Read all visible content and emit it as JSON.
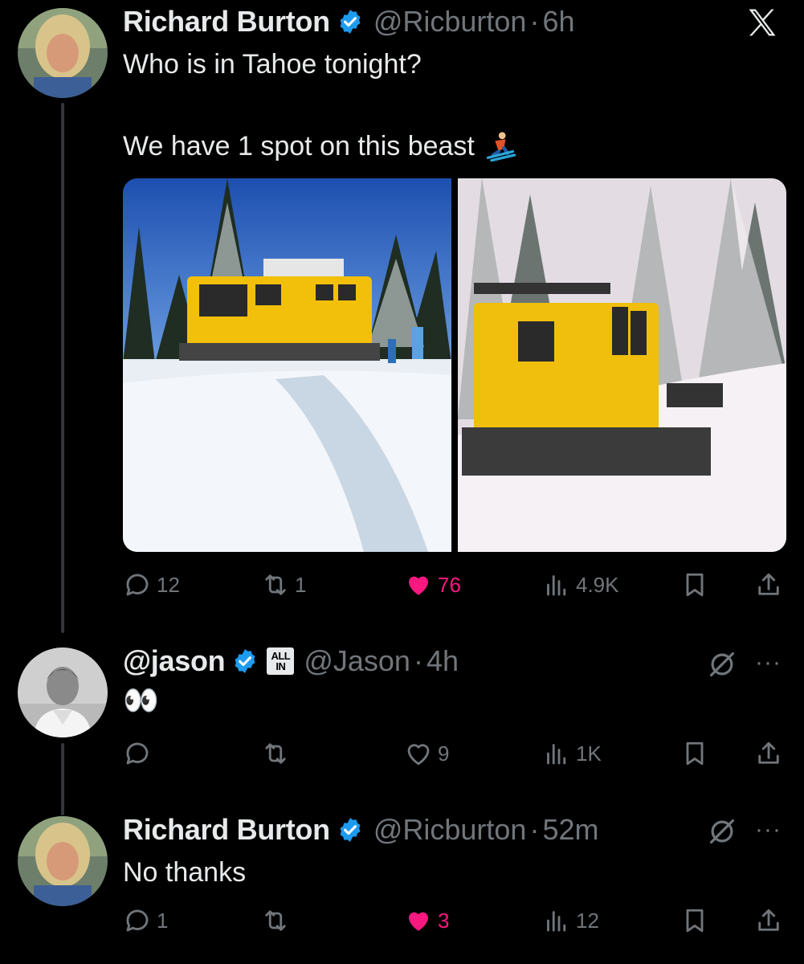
{
  "app": {
    "logo": "x-logo"
  },
  "tweets": [
    {
      "name": "Richard Burton",
      "handle": "@Ricburton",
      "separator": "·",
      "time": "6h",
      "text_line1": "Who is in Tahoe tonight?",
      "text_line2": "We have 1 spot on this beast",
      "emoji": "skier",
      "replies": "12",
      "reposts": "1",
      "likes": "76",
      "views": "4.9K",
      "liked": true
    },
    {
      "name": "@jason",
      "handle": "@Jason",
      "separator": "·",
      "time": "4h",
      "affiliate_badge_line1": "ALL",
      "affiliate_badge_line2": "IN",
      "text_line1": "👀",
      "replies": "",
      "reposts": "",
      "likes": "9",
      "views": "1K",
      "liked": false,
      "more": "···"
    },
    {
      "name": "Richard Burton",
      "handle": "@Ricburton",
      "separator": "·",
      "time": "52m",
      "text_line1": "No thanks",
      "replies": "1",
      "reposts": "",
      "likes": "3",
      "views": "12",
      "liked": true,
      "more": "···"
    }
  ],
  "colors": {
    "background": "#000000",
    "text": "#e7e9ea",
    "secondary": "#71767b",
    "like": "#f91880",
    "verified": "#1d9bf0"
  }
}
